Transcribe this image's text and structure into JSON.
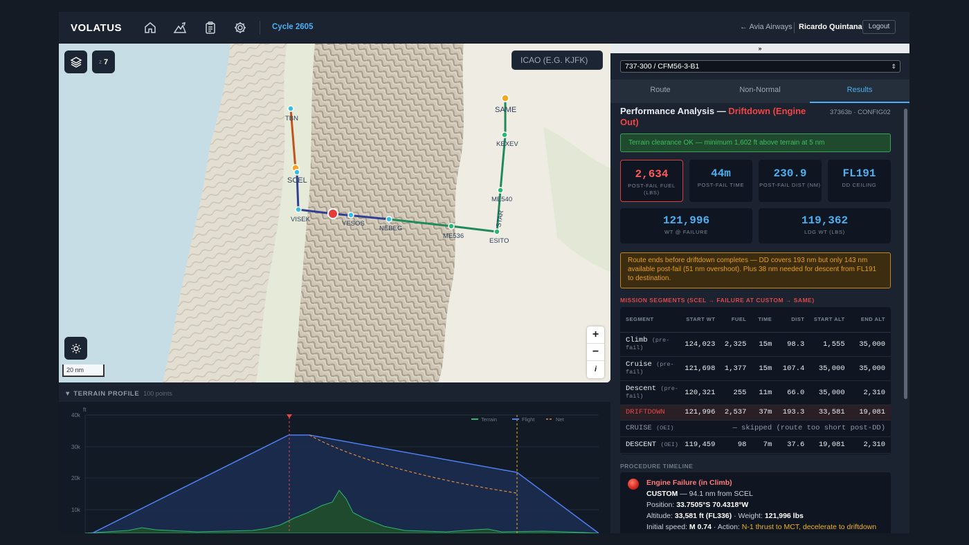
{
  "header": {
    "logo": "VOLATUS",
    "nav_icons": [
      "home-icon",
      "terrain-icon",
      "clipboard-icon",
      "gear-icon"
    ],
    "cycle": "Cycle 2605",
    "airline": "← Avia Airways",
    "user": "Ricardo Quintana",
    "logout": "Logout"
  },
  "map": {
    "layers_icon": "layers-icon",
    "zoom_label": "z",
    "zoom_value": "7",
    "icao_placeholder": "ICAO (E.G. KJFK)",
    "zoom_in": "+",
    "zoom_out": "−",
    "compass": "i",
    "scale": "20 nm",
    "waypoints": [
      "TBN",
      "SCEL",
      "VISEK",
      "YESOS",
      "NEBEG",
      "ME536",
      "ESITO",
      "STAR",
      "ME540",
      "KEXEV",
      "SAME"
    ]
  },
  "terrain": {
    "title": "▼ TERRAIN PROFILE",
    "points": "100 points",
    "unit": "ft",
    "yticks": [
      "40k",
      "30k",
      "20k",
      "10k"
    ],
    "legend": [
      "Terrain",
      "Flight",
      "Net"
    ]
  },
  "panel": {
    "collapse": "»",
    "aircraft": "737-300 / CFM56-3-B1",
    "tabs": [
      "Route",
      "Non-Normal",
      "Results"
    ],
    "title_prefix": "Performance Analysis — ",
    "title_red": "Driftdown (Engine Out)",
    "ref": "37363b · CONFIG02",
    "ok_banner": "Terrain clearance OK — minimum 1,602 ft above terrain at 5 nm",
    "tiles": [
      {
        "value": "2,634",
        "label": "POST-FAIL FUEL (LBS)"
      },
      {
        "value": "44m",
        "label": "POST-FAIL TIME"
      },
      {
        "value": "230.9",
        "label": "POST-FAIL DIST (NM)"
      },
      {
        "value": "FL191",
        "label": "DD CEILING"
      },
      {
        "value": "121,996",
        "label": "WT @ FAILURE"
      },
      {
        "value": "119,362",
        "label": "LDG WT (LBS)"
      }
    ],
    "warning": "Route ends before driftdown completes — DD covers 193 nm but only 143 nm available post-fail (51 nm overshoot). Plus 38 nm needed for descent from FL191 to destination.",
    "segments_title": "MISSION SEGMENTS (SCEL → FAILURE AT CUSTOM → SAME)",
    "seg_headers": [
      "SEGMENT",
      "START WT",
      "FUEL",
      "TIME",
      "DIST",
      "START ALT",
      "END ALT"
    ],
    "seg_rows": [
      {
        "name": "Climb",
        "sub": "(pre-fail)",
        "cells": [
          "124,023",
          "2,325",
          "15m",
          "98.3",
          "1,555",
          "35,000"
        ]
      },
      {
        "name": "Cruise",
        "sub": "(pre-fail)",
        "cells": [
          "121,698",
          "1,377",
          "15m",
          "107.4",
          "35,000",
          "35,000"
        ]
      },
      {
        "name": "Descent",
        "sub": "(pre-fail)",
        "cells": [
          "120,321",
          "255",
          "11m",
          "66.0",
          "35,000",
          "2,310"
        ]
      },
      {
        "name": "DRIFTDOWN",
        "sub": "",
        "cells": [
          "121,996",
          "2,537",
          "37m",
          "193.3",
          "33,581",
          "19,081"
        ]
      }
    ],
    "seg_skipped": {
      "name": "CRUISE",
      "sub": "(OEI)",
      "note": "— skipped (route too short post-DD)"
    },
    "seg_descent": {
      "name": "DESCENT",
      "sub": "(OEI)",
      "cells": [
        "119,459",
        "98",
        "7m",
        "37.6",
        "19,081",
        "2,310"
      ]
    },
    "timeline_title": "PROCEDURE TIMELINE",
    "timeline": {
      "event": "Engine Failure (in Climb)",
      "custom": "CUSTOM",
      "custom_rest": " — 94.1 nm from SCEL",
      "position_label": "Position: ",
      "position": "33.7505°S 70.4318°W",
      "altitude_label": "Altitude: ",
      "altitude": "33,581 ft (FL336)",
      "weight_label": " · Weight: ",
      "weight": "121,996 lbs",
      "speed_label": "Initial speed: ",
      "speed": "M 0.74",
      "action_label": " · Action: ",
      "action": "N-1 thrust to MCT, decelerate to driftdown"
    }
  }
}
